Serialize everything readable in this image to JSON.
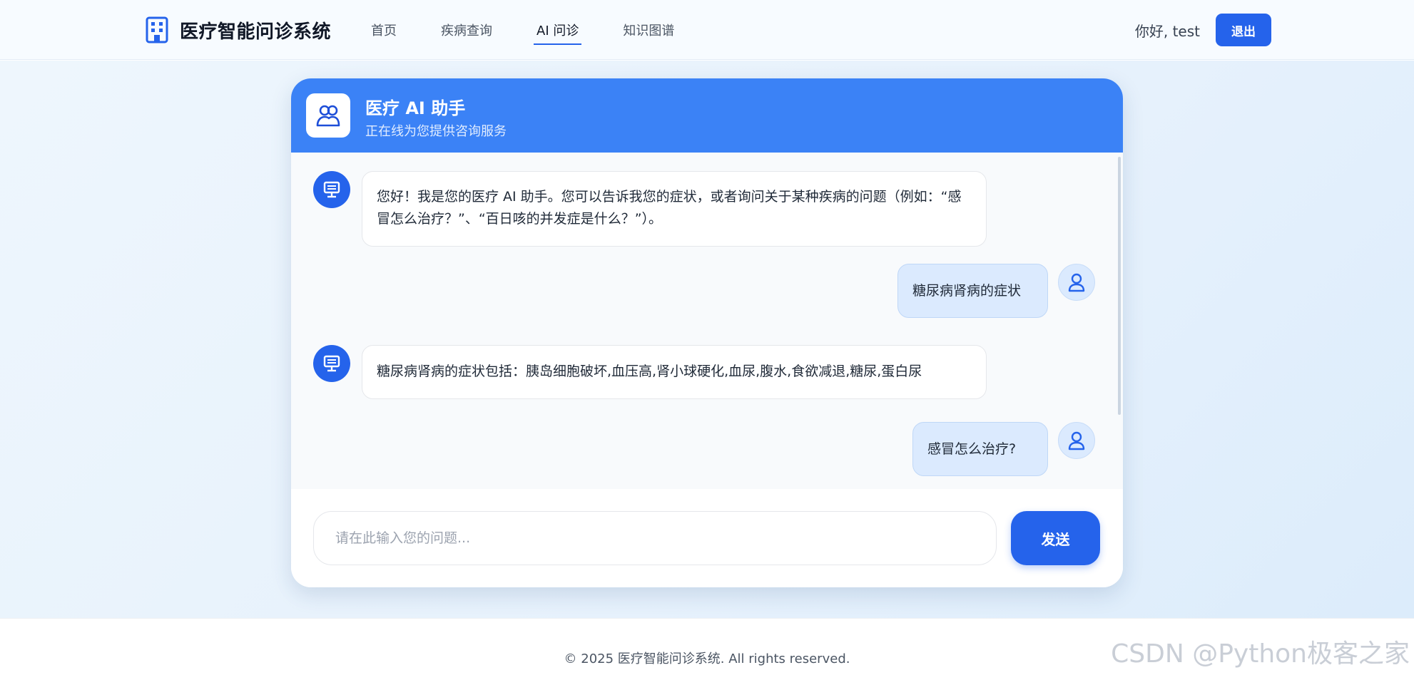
{
  "header": {
    "brand_title": "医疗智能问诊系统",
    "nav": [
      {
        "label": "首页",
        "active": false
      },
      {
        "label": "疾病查询",
        "active": false
      },
      {
        "label": "AI 问诊",
        "active": true
      },
      {
        "label": "知识图谱",
        "active": false
      }
    ],
    "greeting": "你好, test",
    "logout_label": "退出"
  },
  "chat": {
    "assistant_name": "医疗 AI 助手",
    "assistant_status": "正在线为您提供咨询服务",
    "messages": [
      {
        "role": "assistant",
        "text": "您好！我是您的医疗 AI 助手。您可以告诉我您的症状，或者询问关于某种疾病的问题（例如：“感冒怎么治疗？”、“百日咳的并发症是什么？”）。"
      },
      {
        "role": "user",
        "text": "糖尿病肾病的症状"
      },
      {
        "role": "assistant",
        "text": "糖尿病肾病的症状包括：胰岛细胞破坏,血压高,肾小球硬化,血尿,腹水,食欲减退,糖尿,蛋白尿"
      },
      {
        "role": "user",
        "text": "感冒怎么治疗?"
      }
    ],
    "input_placeholder": "请在此输入您的问题...",
    "send_label": "发送"
  },
  "footer": {
    "copyright": "© 2025 医疗智能问诊系统. All rights reserved.",
    "watermark": "CSDN @Python极客之家"
  },
  "colors": {
    "primary": "#2563eb",
    "header_blue": "#3b82f6",
    "user_bubble": "#dbeafe"
  },
  "icons": {
    "logo": "hospital-building-icon",
    "assistant": "users-icon",
    "bot": "monitor-icon",
    "user": "user-icon"
  }
}
